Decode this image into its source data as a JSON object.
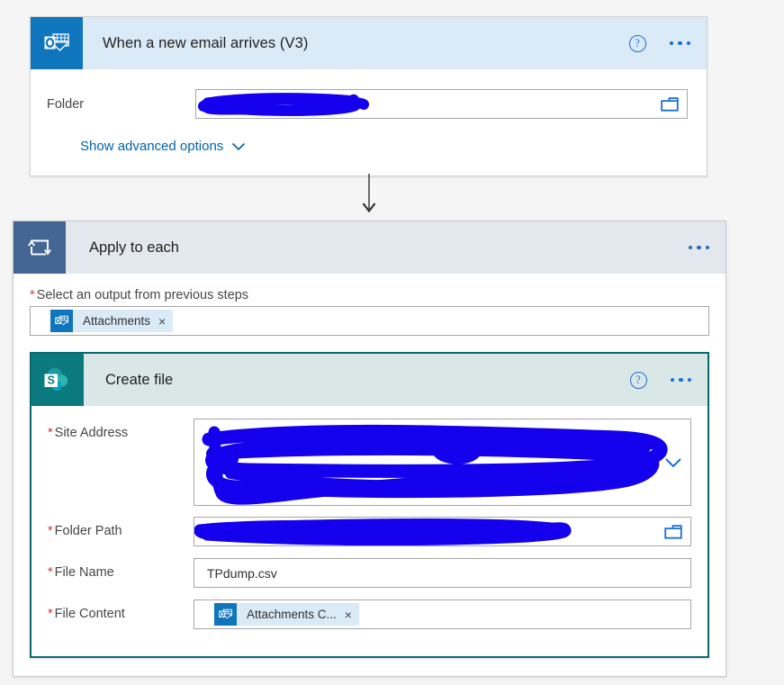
{
  "page": {
    "background_color": "#f5f5f5",
    "redaction_color": "#1400ec"
  },
  "trigger_card": {
    "title": "When a new email arrives (V3)",
    "icon": "outlook-icon",
    "header_color": "#daeaf7",
    "icon_bg": "#0f75bd",
    "help_label": "?",
    "more_label": "•••",
    "fields": [
      {
        "label": "Folder",
        "value": "",
        "redacted": true,
        "trailing_icon": "folder-picker-icon"
      }
    ],
    "advanced_link": "Show advanced options",
    "advanced_icon": "chevron-down-icon"
  },
  "connector": {
    "icon": "down-arrow-icon",
    "color": "#5c5c5c"
  },
  "loop_card": {
    "title": "Apply to each",
    "icon": "loop-icon",
    "header_color": "#e3e8ef",
    "icon_bg": "#436694",
    "more_label": "•••",
    "output_label": "Select an output from previous steps",
    "output_required": true,
    "output_token": {
      "label": "Attachments",
      "icon": "outlook-icon",
      "close_label": "×"
    }
  },
  "create_file_card": {
    "title": "Create file",
    "icon": "sharepoint-icon",
    "header_color": "#d9e8e7",
    "icon_bg": "#0b7a7f",
    "border_color": "#0b6a6f",
    "help_label": "?",
    "more_label": "•••",
    "fields": [
      {
        "label": "Site Address",
        "required": true,
        "value": "",
        "redacted": true,
        "kind": "dropdown-tall",
        "trailing_icon": "chevron-down-icon"
      },
      {
        "label": "Folder Path",
        "required": true,
        "value": "",
        "redacted": true,
        "kind": "picker",
        "trailing_icon": "folder-picker-icon"
      },
      {
        "label": "File Name",
        "required": true,
        "value": "TPdump.csv",
        "redacted": false,
        "kind": "text",
        "trailing_icon": ""
      },
      {
        "label": "File Content",
        "required": true,
        "value": "",
        "redacted": false,
        "kind": "token",
        "trailing_icon": "",
        "token": {
          "label": "Attachments C...",
          "icon": "outlook-icon",
          "close_label": "×"
        }
      }
    ]
  }
}
